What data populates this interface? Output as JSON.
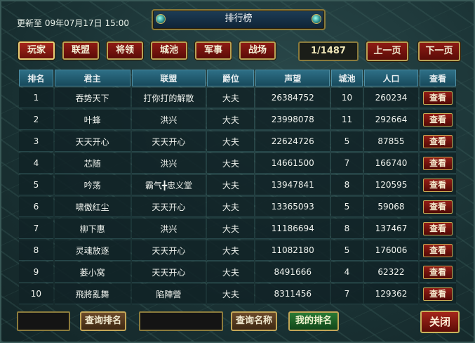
{
  "header": {
    "updated": "更新至 09年07月17日 15:00",
    "title": "排行榜"
  },
  "tabs": [
    "玩家",
    "联盟",
    "将领",
    "城池",
    "军事",
    "战场"
  ],
  "pager": {
    "indicator": "1/1487",
    "prev": "上一页",
    "next": "下一页"
  },
  "table": {
    "columns": [
      "排名",
      "君主",
      "联盟",
      "爵位",
      "声望",
      "城池",
      "人口",
      "查看"
    ],
    "rows": [
      [
        "1",
        "吞势天下",
        "打你打的解散",
        "大夫",
        "26384752",
        "10",
        "260234",
        "查看"
      ],
      [
        "2",
        "叶蜂",
        "洪兴",
        "大夫",
        "23998078",
        "11",
        "292664",
        "查看"
      ],
      [
        "3",
        "天天开心",
        "天天开心",
        "大夫",
        "22624726",
        "5",
        "87855",
        "查看"
      ],
      [
        "4",
        "芯随",
        "洪兴",
        "大夫",
        "14661500",
        "7",
        "166740",
        "查看"
      ],
      [
        "5",
        "吟荡",
        "霸气╋忠义堂",
        "大夫",
        "13947841",
        "8",
        "120595",
        "查看"
      ],
      [
        "6",
        "啸傲红尘",
        "天天开心",
        "大夫",
        "13365093",
        "5",
        "59068",
        "查看"
      ],
      [
        "7",
        "柳下惠",
        "洪兴",
        "大夫",
        "11186694",
        "8",
        "137467",
        "查看"
      ],
      [
        "8",
        "灵魂放逐",
        "天天开心",
        "大夫",
        "11082180",
        "5",
        "176006",
        "查看"
      ],
      [
        "9",
        "蒌小窝",
        "天天开心",
        "大夫",
        "8491666",
        "4",
        "62322",
        "查看"
      ],
      [
        "10",
        "飛將亂舞",
        "陷陣營",
        "大夫",
        "8311456",
        "7",
        "129362",
        "查看"
      ]
    ]
  },
  "footer": {
    "query_rank": "查询排名",
    "query_name": "查询名称",
    "my_rank": "我的排名",
    "close": "关闭"
  }
}
